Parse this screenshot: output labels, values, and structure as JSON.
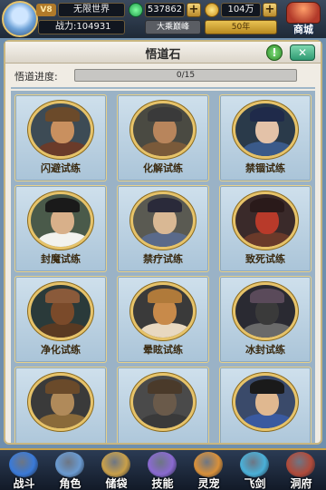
{
  "hud": {
    "vip_level": "V8",
    "server_name": "无限世界",
    "power_label": "战力:104931",
    "jade_amount": "537862",
    "gold_amount": "104万",
    "realm": "大乘巅峰",
    "years": "50年",
    "plus": "+",
    "shop_label": "商城"
  },
  "panel": {
    "title": "悟道石",
    "help_symbol": "!",
    "close_symbol": "✕",
    "progress_label": "悟道进度:",
    "progress_text": "0/15",
    "progress_fraction": 0
  },
  "trials": [
    {
      "label": "闪避试练",
      "face": "#c9905f",
      "hat": "#6b4a2a",
      "body": "#6a3b2a",
      "bg": "#3d4b55"
    },
    {
      "label": "化解试练",
      "face": "#b8855c",
      "hat": "#3a3a3a",
      "body": "#7a5a3a",
      "bg": "#4a4a42"
    },
    {
      "label": "禁锢试练",
      "face": "#e3c2a8",
      "hat": "#1f2a4a",
      "body": "#3a5a8a",
      "bg": "#2a3a4a"
    },
    {
      "label": "封魔试练",
      "face": "#d8b08a",
      "hat": "#1a1a1a",
      "body": "#f2f2ee",
      "bg": "#4a5a4a"
    },
    {
      "label": "禁疗试练",
      "face": "#d9b894",
      "hat": "#2a2a3a",
      "body": "#5a6a8a",
      "bg": "#5a5a52"
    },
    {
      "label": "致死试练",
      "face": "#b83a2a",
      "hat": "#2a1a1a",
      "body": "#6a3a2a",
      "bg": "#3a2a2a"
    },
    {
      "label": "净化试练",
      "face": "#7a4a2a",
      "hat": "#8a5a3a",
      "body": "#5a3a22",
      "bg": "#2a3a3a"
    },
    {
      "label": "晕眩试练",
      "face": "#c88a4a",
      "hat": "#b07a3a",
      "body": "#e8d8c0",
      "bg": "#3a3a3a"
    },
    {
      "label": "冰封试练",
      "face": "#3a3a3a",
      "hat": "#5a4a5a",
      "body": "#6a6a6a",
      "bg": "#2a2a32"
    },
    {
      "label": "",
      "face": "#b08a5a",
      "hat": "#6a4a2a",
      "body": "#8a6a3a",
      "bg": "#3a3a3a"
    },
    {
      "label": "",
      "face": "#6a5a4a",
      "hat": "#4a3a2a",
      "body": "#3a3a3a",
      "bg": "#4a4a4a"
    },
    {
      "label": "",
      "face": "#e0b890",
      "hat": "#1a1a1a",
      "body": "#3a5aa0",
      "bg": "#3a4a6a"
    }
  ],
  "nav": [
    {
      "label": "战斗",
      "color": "#3a7ad8"
    },
    {
      "label": "角色",
      "color": "#6a9ad0"
    },
    {
      "label": "储袋",
      "color": "#c9a04a"
    },
    {
      "label": "技能",
      "color": "#8a6ad0"
    },
    {
      "label": "灵宠",
      "color": "#d8903a"
    },
    {
      "label": "飞剑",
      "color": "#4ab0d8"
    },
    {
      "label": "洞府",
      "color": "#b04a3a"
    }
  ]
}
